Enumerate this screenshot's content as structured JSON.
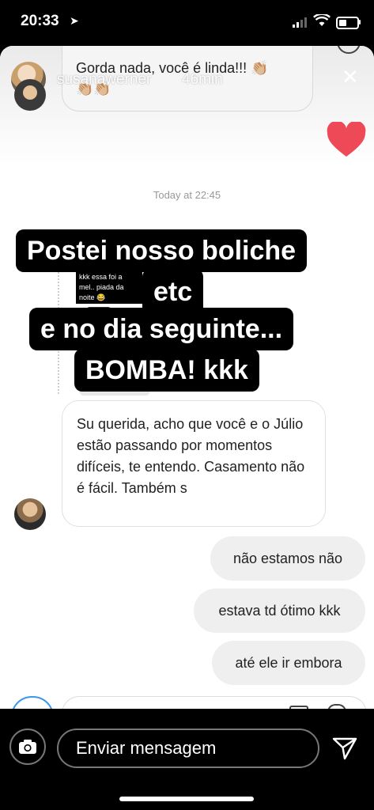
{
  "status_bar": {
    "time": "20:33"
  },
  "story": {
    "username": "susanawerner",
    "time_ago": "46min",
    "previous_message": "Gorda nada, você é linda!!! 👏🏼",
    "previous_message_emoji": "👏🏼👏🏼"
  },
  "chat": {
    "timestamp": "Today at 22:45",
    "shared_post_caption": "kkk essa foi a mel.. piada da noite 😂",
    "incoming_message": "Su querida, acho que você e o Júlio estão passando por momentos difíceis, te entendo. Casamento não é fácil. Também s",
    "outgoing_messages": [
      "não estamos não",
      "estava td ótimo kkk",
      "até ele ir embora"
    ]
  },
  "overlay_text": {
    "line1": "Postei nosso boliche",
    "line2": "etc",
    "line3": "e no dia seguinte...",
    "line4": "BOMBA! kkk"
  },
  "reply_bar": {
    "placeholder": "Enviar mensagem"
  },
  "colors": {
    "heart": "#ed4956",
    "camera_ring": "#3897f0"
  }
}
